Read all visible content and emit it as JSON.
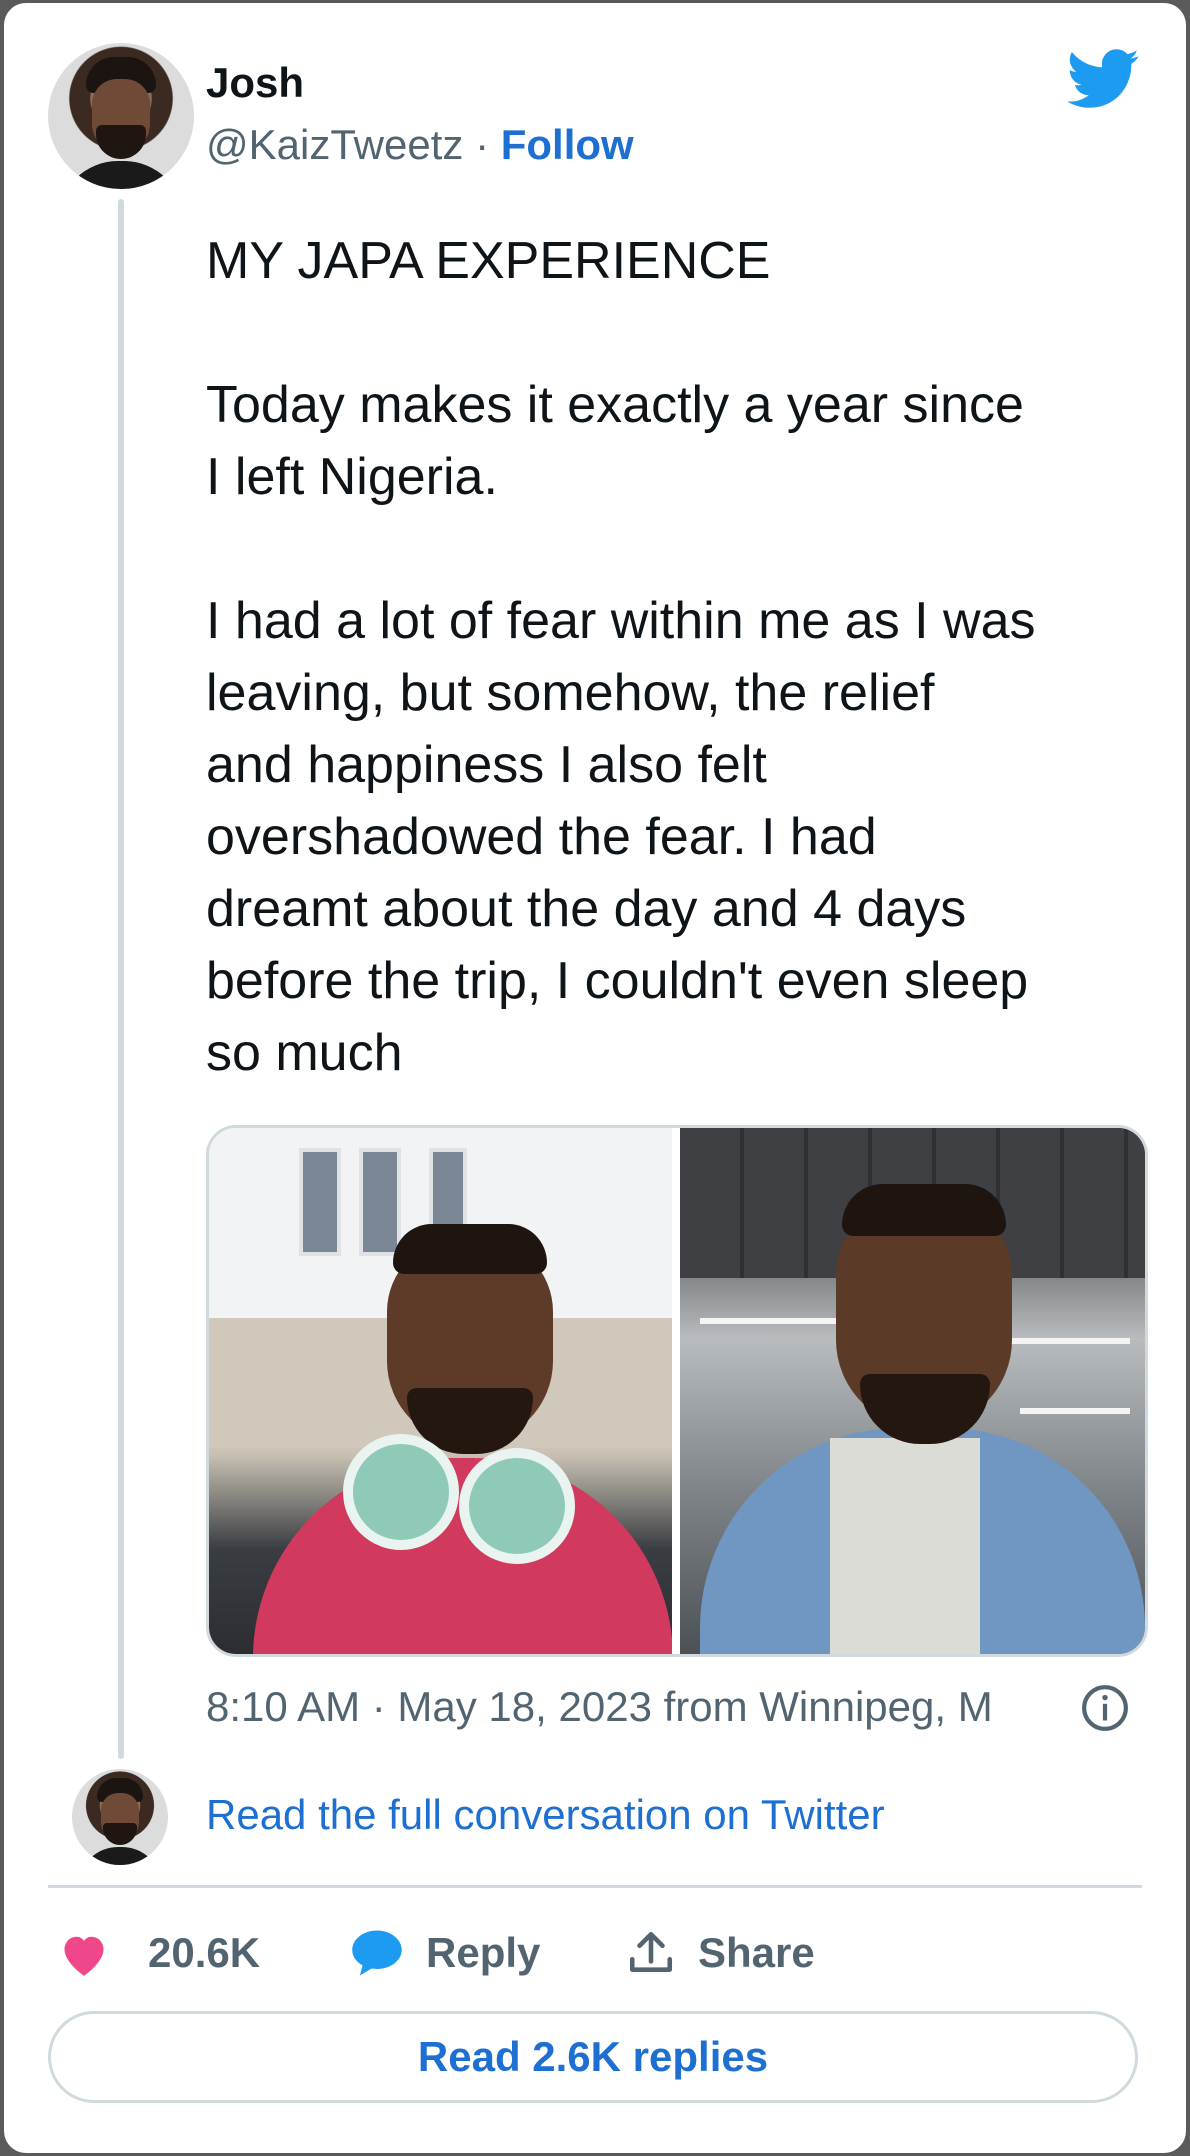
{
  "author": {
    "name": "Josh",
    "handle": "@KaizTweetz",
    "separator": " · ",
    "follow_label": "Follow"
  },
  "tweet": {
    "text": "MY JAPA EXPERIENCE\n\nToday makes it exactly a year since\nI left Nigeria.\n\nI had a lot of fear within me as I was\nleaving, but somehow, the relief\nand happiness I also felt\novershadowed the fear. I had\ndreamt about the day and 4 days\nbefore the trip, I couldn't even sleep\nso much",
    "timestamp": "8:10 AM · May 18, 2023 from Winnipeg, M"
  },
  "thread": {
    "read_full_label": "Read the full conversation on Twitter"
  },
  "actions": {
    "likes": "20.6K",
    "reply_label": "Reply",
    "share_label": "Share",
    "read_replies_label": "Read 2.6K replies"
  },
  "colors": {
    "accent": "#1d6fd1",
    "twitter_blue": "#1d9bf0",
    "like_pink": "#f0468a",
    "muted": "#536471",
    "border": "#cfd9de"
  },
  "icons": {
    "brand": "twitter-bird-icon",
    "info": "info-icon",
    "like": "heart-icon",
    "reply": "speech-bubble-icon",
    "share": "share-upload-icon"
  }
}
